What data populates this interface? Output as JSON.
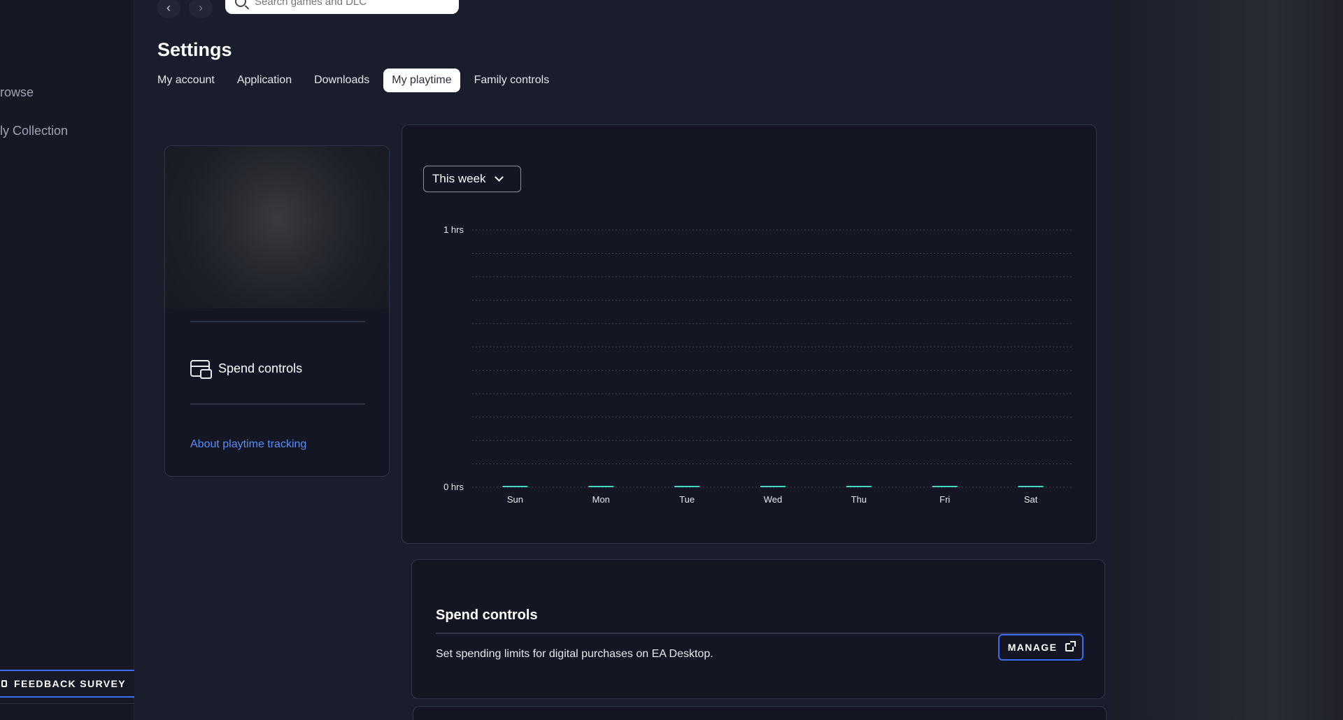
{
  "nav": {
    "browse_label": "rowse",
    "collection_label": "ly Collection",
    "feedback_label": "FEEDBACK SURVEY"
  },
  "search": {
    "placeholder": "Search games and DLC"
  },
  "page": {
    "title": "Settings"
  },
  "tabs": [
    {
      "label": "My account"
    },
    {
      "label": "Application"
    },
    {
      "label": "Downloads"
    },
    {
      "label": "My playtime",
      "active": true
    },
    {
      "label": "Family controls"
    }
  ],
  "left_card": {
    "spend_controls_label": "Spend controls",
    "about_link": "About playtime tracking"
  },
  "chart_data": {
    "type": "bar",
    "categories": [
      "Sun",
      "Mon",
      "Tue",
      "Wed",
      "Thu",
      "Fri",
      "Sat"
    ],
    "values": [
      0,
      0,
      0,
      0,
      0,
      0,
      0
    ],
    "ytick_labels": [
      "0 hrs",
      "1 hrs"
    ],
    "ylim": [
      0,
      1
    ],
    "grid": true,
    "bar_color": "#3fd6c0",
    "range_label": "This week"
  },
  "spend_section": {
    "title": "Spend controls",
    "description": "Set spending limits for digital purchases on EA Desktop.",
    "manage_label": "MANAGE"
  },
  "colors": {
    "accent": "#3d6cf0",
    "link": "#5a8cf5",
    "bar": "#3fd6c0"
  }
}
